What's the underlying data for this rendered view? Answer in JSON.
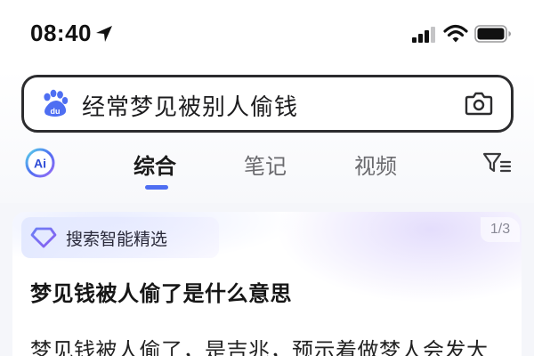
{
  "status_bar": {
    "time": "08:40",
    "icons": [
      "location-arrow-icon",
      "signal-icon",
      "wifi-icon",
      "battery-icon"
    ]
  },
  "search": {
    "query": "经常梦见被别人偷钱",
    "logo": "baidu-paw-icon",
    "camera": "camera-icon"
  },
  "tabs": {
    "ai_label": "Ai",
    "items": [
      "综合",
      "笔记",
      "视频"
    ],
    "active_index": 0,
    "filter": "filter-icon"
  },
  "card": {
    "tag": "搜索智能精选",
    "page": "1/3",
    "title": "梦见钱被人偷了是什么意思",
    "body": "梦见钱被人偷了，是吉兆，预示着做梦人会发大"
  },
  "colors": {
    "accent": "#4e6ef2",
    "text_primary": "#1a1a1a",
    "text_secondary": "#6a6a6e",
    "background": "#f5f6fa"
  }
}
